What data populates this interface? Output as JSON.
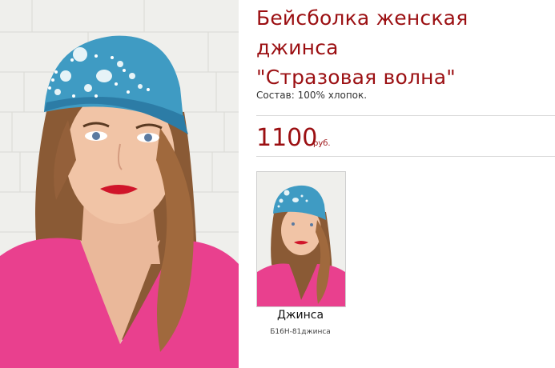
{
  "product": {
    "title_line1": "Бейсболка женская джинса",
    "title_line2": "\"Стразовая волна\"",
    "composition": "Состав: 100% хлопок.",
    "price": "1100",
    "currency": "руб."
  },
  "variants": [
    {
      "name": "Джинса",
      "code": "Б16Н-81джинса"
    }
  ],
  "colors": {
    "accent": "#9b0f12",
    "divider": "#d9d9d9"
  }
}
